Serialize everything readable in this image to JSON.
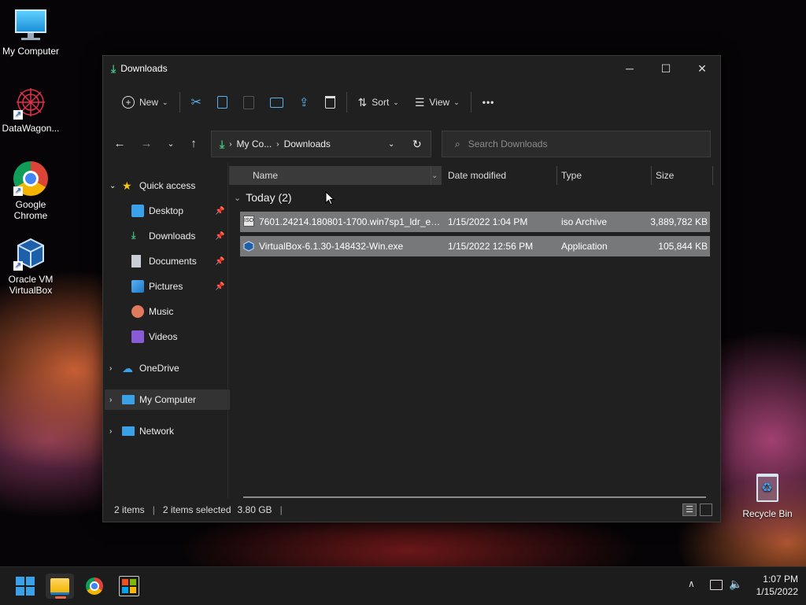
{
  "desktop": {
    "icons": [
      {
        "label": "My Computer"
      },
      {
        "label": "DataWagon..."
      },
      {
        "label": "Google Chrome"
      },
      {
        "label": "Oracle VM VirtualBox"
      },
      {
        "label": "Recycle Bin"
      }
    ]
  },
  "window": {
    "title": "Downloads",
    "controls": {
      "minimize": "─",
      "maximize": "☐",
      "close": "✕"
    }
  },
  "toolbar": {
    "new_label": "New",
    "sort_label": "Sort",
    "view_label": "View",
    "more_label": "•••"
  },
  "address": {
    "crumbs": [
      "My Co...",
      "Downloads"
    ],
    "search_placeholder": "Search Downloads"
  },
  "sidebar": {
    "quick_access": "Quick access",
    "items": [
      {
        "label": "Desktop",
        "icon": "desktop-icon",
        "pinned": true
      },
      {
        "label": "Downloads",
        "icon": "downloads-icon",
        "pinned": true
      },
      {
        "label": "Documents",
        "icon": "documents-icon",
        "pinned": true
      },
      {
        "label": "Pictures",
        "icon": "pictures-icon",
        "pinned": true
      },
      {
        "label": "Music",
        "icon": "music-icon",
        "pinned": false
      },
      {
        "label": "Videos",
        "icon": "videos-icon",
        "pinned": false
      }
    ],
    "onedrive": "OneDrive",
    "my_computer": "My Computer",
    "network": "Network"
  },
  "columns": {
    "name": "Name",
    "date": "Date modified",
    "type": "Type",
    "size": "Size"
  },
  "group": {
    "label": "Today (2)"
  },
  "files": [
    {
      "name": "7601.24214.180801-1700.win7sp1_ldr_escr...",
      "date": "1/15/2022 1:04 PM",
      "type": "iso Archive",
      "size": "3,889,782 KB"
    },
    {
      "name": "VirtualBox-6.1.30-148432-Win.exe",
      "date": "1/15/2022 12:56 PM",
      "type": "Application",
      "size": "105,844 KB"
    }
  ],
  "status": {
    "count": "2 items",
    "selected": "2 items selected",
    "size": "3.80 GB"
  },
  "taskbar": {
    "time": "1:07 PM",
    "date": "1/15/2022"
  },
  "colors": {
    "accent": "#3aa0e8",
    "selection": "#77787a",
    "window_bg": "#202020"
  }
}
